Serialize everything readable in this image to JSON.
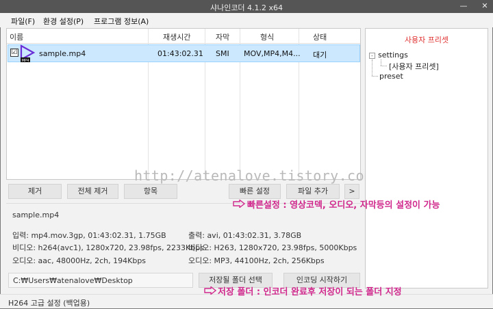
{
  "window": {
    "title": "샤나인코더 4.1.2 x64",
    "minimize_glyph": "—",
    "close_glyph": "✕"
  },
  "menu": [
    "파일(F)",
    "환경 설정(P)",
    "프로그램 정보(A)"
  ],
  "filelist": {
    "columns": [
      "이름",
      "재생시간",
      "자막",
      "형식",
      "상태"
    ],
    "rows": [
      {
        "checked": "☑",
        "name": "sample.mp4",
        "duration": "01:43:02.31",
        "subtitle": "SMI",
        "format": "MOV,MP4,M4...",
        "status": "대기",
        "icon": "play-icon",
        "icon_badge": "MP4"
      }
    ]
  },
  "watermark": "http://atenalove.tistory.com",
  "left_buttons": [
    "제거",
    "전체 제거",
    "항목"
  ],
  "right_buttons": [
    "빠른 설정",
    "파일 추가",
    ">"
  ],
  "info": {
    "filename": "sample.mp4",
    "input": "입력: mp4.mov.3gp, 01:43:02.31, 1.75GB",
    "input_video": "비디오: h264(avc1), 1280x720, 23.98fps, 2233Kbps",
    "input_audio": "오디오: aac, 48000Hz, 2ch, 194Kbps",
    "output": "출력: avi, 01:43:02.31, 3.78GB",
    "output_video": "비디오: H263, 1280x720, 23.98fps, 5000Kbps",
    "output_audio": "오디오: MP3, 44100Hz, 2ch, 256Kbps"
  },
  "output_path": "C:₩Users₩atenalove₩Desktop",
  "folder_button": "저장될 폴더 선택",
  "encode_button": "인코딩 시작하기",
  "status": "H264 고급 설정 (백업용)",
  "preset_panel": {
    "title": "사용자 프리셋",
    "tree": [
      "settings",
      "[사용자 프리셋]",
      "preset"
    ],
    "expander": "-"
  },
  "annotations": {
    "quick_settings": "빠른설정 : 영상코덱, 오디오, 자막등의 설정이 가능",
    "save_folder": "저장 폴더 : 인코더 완료후 저장이 되는 폴더 지정"
  },
  "colors": {
    "accent_annotation": "#d0288c",
    "preset_title": "#e03030",
    "selection": "#cce8ff"
  }
}
